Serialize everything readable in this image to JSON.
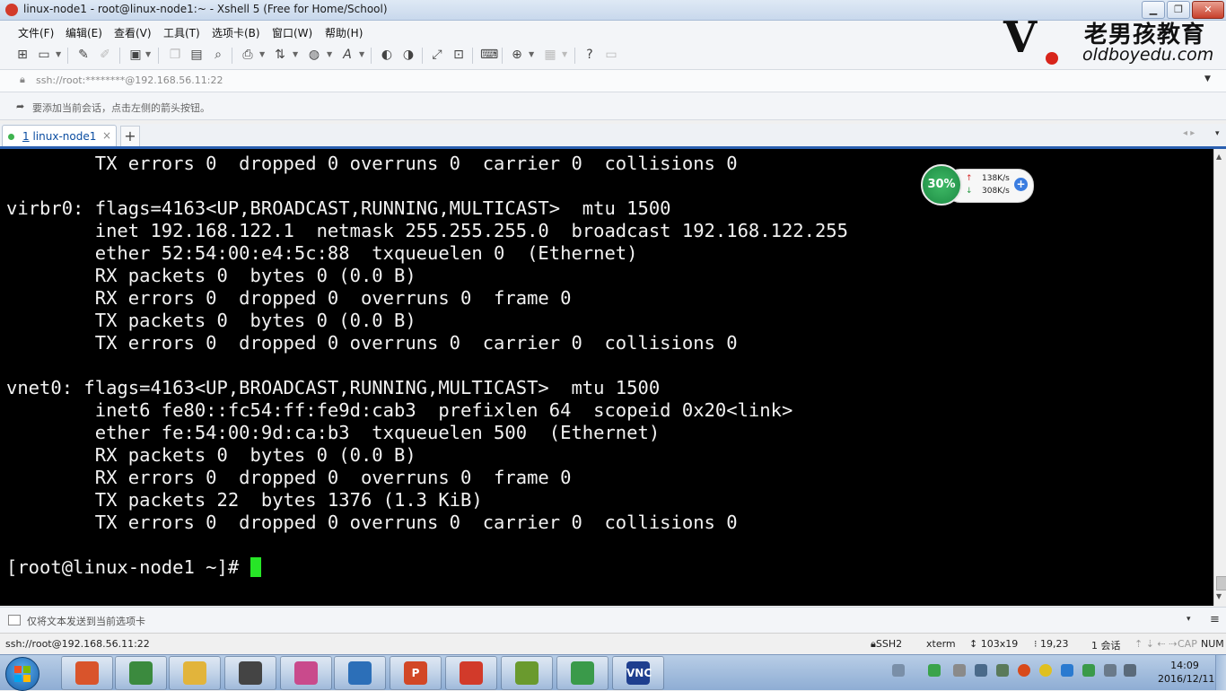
{
  "window": {
    "title": "linux-node1 - root@linux-node1:~ - Xshell 5 (Free for Home/School)",
    "controls": {
      "minimize": "▁",
      "maximize": "❐",
      "close": "✕"
    }
  },
  "menubar": {
    "items": [
      "文件(F)",
      "编辑(E)",
      "查看(V)",
      "工具(T)",
      "选项卡(B)",
      "窗口(W)",
      "帮助(H)"
    ]
  },
  "toolbar": {
    "icons": [
      "new-session-icon",
      "open-folder-icon",
      "reconnect-icon",
      "disconnect-icon",
      "properties-icon",
      "copy-icon",
      "paste-icon",
      "find-icon",
      "print-icon",
      "transfer-icon",
      "globe-icon",
      "font-icon",
      "xftp-icon",
      "xmanager-icon",
      "fullscreen-icon",
      "lock-icon",
      "keyboard-icon",
      "compose-icon",
      "layout-icon",
      "help-icon",
      "chat-icon"
    ]
  },
  "logo": {
    "cn": "老男孩教育",
    "en": "oldboyedu.com"
  },
  "addressbar": {
    "value": "ssh://root:********@192.168.56.11:22"
  },
  "hintbar": {
    "text": "要添加当前会话，点击左侧的箭头按钮。"
  },
  "tabs": [
    {
      "number": "1",
      "label": "linux-node1",
      "status_color": "#3fb34f"
    }
  ],
  "tabbar": {
    "add": "+",
    "nav": "◂ ▸",
    "menu": "▾"
  },
  "terminal": {
    "lines": [
      "        TX errors 0  dropped 0 overruns 0  carrier 0  collisions 0",
      "",
      "virbr0: flags=4163<UP,BROADCAST,RUNNING,MULTICAST>  mtu 1500",
      "        inet 192.168.122.1  netmask 255.255.255.0  broadcast 192.168.122.255",
      "        ether 52:54:00:e4:5c:88  txqueuelen 0  (Ethernet)",
      "        RX packets 0  bytes 0 (0.0 B)",
      "        RX errors 0  dropped 0  overruns 0  frame 0",
      "        TX packets 0  bytes 0 (0.0 B)",
      "        TX errors 0  dropped 0 overruns 0  carrier 0  collisions 0",
      "",
      "vnet0: flags=4163<UP,BROADCAST,RUNNING,MULTICAST>  mtu 1500",
      "        inet6 fe80::fc54:ff:fe9d:cab3  prefixlen 64  scopeid 0x20<link>",
      "        ether fe:54:00:9d:ca:b3  txqueuelen 500  (Ethernet)",
      "        RX packets 0  bytes 0 (0.0 B)",
      "        RX errors 0  dropped 0  overruns 0  frame 0",
      "        TX packets 22  bytes 1376 (1.3 KiB)",
      "        TX errors 0  dropped 0 overruns 0  carrier 0  collisions 0",
      "",
      "[root@linux-node1 ~]# "
    ],
    "cursor_color": "#27e627",
    "background": "#000000",
    "foreground": "#f2f2f2"
  },
  "netwidget": {
    "percent": "30%",
    "upload": "138K/s",
    "download": "308K/s",
    "up_arrow": "↑",
    "down_arrow": "↓",
    "plus": "+"
  },
  "sendbar": {
    "placeholder": "仅将文本发送到当前选项卡",
    "dropdown": "▾",
    "menu": "≡"
  },
  "statusbar": {
    "connection": "ssh://root@192.168.56.11:22",
    "protocol": "SSH2",
    "terminal_type": "xterm",
    "size": "103x19",
    "cursor_pos": "19,23",
    "sessions": "1 会话",
    "caps": "CAP",
    "num": "NUM"
  },
  "taskbar": {
    "apps": [
      {
        "name": "windows-media-icon",
        "color": "#d9542b"
      },
      {
        "name": "chrome-icon",
        "color": "#3b8a3e"
      },
      {
        "name": "explorer-folder-icon",
        "color": "#e2b43b"
      },
      {
        "name": "camera-recorder-icon",
        "color": "#444444"
      },
      {
        "name": "paint-app-icon",
        "color": "#c94a8c"
      },
      {
        "name": "virtualbox-icon",
        "color": "#2c6fb8"
      },
      {
        "name": "powerpoint-icon",
        "color": "#d24726"
      },
      {
        "name": "xshell-icon",
        "color": "#d23a2a"
      },
      {
        "name": "notepad-chart-icon",
        "color": "#6a9a2e"
      },
      {
        "name": "green-app-icon",
        "color": "#3a9a4a"
      },
      {
        "name": "vnc-viewer-icon",
        "color": "#1f3f8f"
      }
    ],
    "vnc_label": "VNC",
    "ppt_label": "P",
    "clock_time": "14:09",
    "clock_date": "2016/12/11"
  }
}
